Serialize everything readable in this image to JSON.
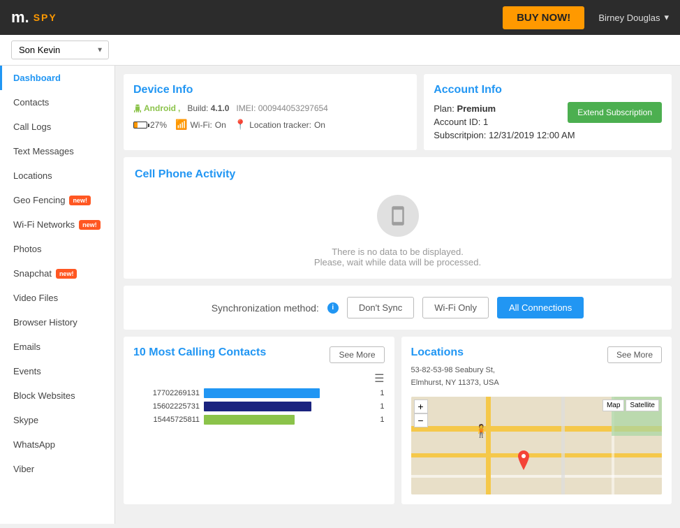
{
  "header": {
    "logo_m": "m.",
    "logo_spy": "SPY",
    "buy_now": "BUY NOW!",
    "user_name": "Birney Douglas"
  },
  "device_selector": {
    "current": "Son Kevin",
    "options": [
      "Son Kevin"
    ]
  },
  "sidebar": {
    "items": [
      {
        "label": "Dashboard",
        "active": true,
        "badge": ""
      },
      {
        "label": "Contacts",
        "active": false,
        "badge": ""
      },
      {
        "label": "Call Logs",
        "active": false,
        "badge": ""
      },
      {
        "label": "Text Messages",
        "active": false,
        "badge": ""
      },
      {
        "label": "Locations",
        "active": false,
        "badge": ""
      },
      {
        "label": "Geo Fencing",
        "active": false,
        "badge": "new!"
      },
      {
        "label": "Wi-Fi Networks",
        "active": false,
        "badge": "new!"
      },
      {
        "label": "Photos",
        "active": false,
        "badge": ""
      },
      {
        "label": "Snapchat",
        "active": false,
        "badge": "new!"
      },
      {
        "label": "Video Files",
        "active": false,
        "badge": ""
      },
      {
        "label": "Browser History",
        "active": false,
        "badge": ""
      },
      {
        "label": "Emails",
        "active": false,
        "badge": ""
      },
      {
        "label": "Events",
        "active": false,
        "badge": ""
      },
      {
        "label": "Block Websites",
        "active": false,
        "badge": ""
      },
      {
        "label": "Skype",
        "active": false,
        "badge": ""
      },
      {
        "label": "WhatsApp",
        "active": false,
        "badge": ""
      },
      {
        "label": "Viber",
        "active": false,
        "badge": ""
      }
    ]
  },
  "device_info": {
    "title": "Device Info",
    "os": "Android",
    "build_label": "Build:",
    "build_value": "4.1.0",
    "imei_label": "IMEI:",
    "imei_value": "000944053297654",
    "battery_pct": "27%",
    "wifi_label": "Wi-Fi:",
    "wifi_value": "On",
    "location_label": "Location tracker:",
    "location_value": "On"
  },
  "account_info": {
    "title": "Account Info",
    "plan_label": "Plan:",
    "plan_value": "Premium",
    "account_label": "Account ID:",
    "account_value": "1",
    "subscription_label": "Subscritpion:",
    "subscription_value": "12/31/2019 12:00 AM",
    "extend_btn": "Extend Subscription"
  },
  "cell_phone_activity": {
    "title": "Cell Phone Activity",
    "no_data_line1": "There is no data to be displayed.",
    "no_data_line2": "Please, wait while data will be processed."
  },
  "sync": {
    "label": "Synchronization method:",
    "dont_sync": "Don't Sync",
    "wifi_only": "Wi-Fi Only",
    "all_connections": "All Connections"
  },
  "contacts_chart": {
    "title": "10 Most Calling Contacts",
    "see_more": "See More",
    "bars": [
      {
        "label": "17702269131",
        "value": 1,
        "color": "#2196f3",
        "width_pct": 70
      },
      {
        "label": "15602225731",
        "value": 1,
        "color": "#1a237e",
        "width_pct": 65
      },
      {
        "label": "15445725811",
        "value": 1,
        "color": "#8bc34a",
        "width_pct": 55
      }
    ]
  },
  "locations": {
    "title": "Locations",
    "address_line1": "53-82-53-98 Seabury St,",
    "address_line2": "Elmhurst, NY 11373, USA",
    "see_more": "See More",
    "map_btn_map": "Map",
    "map_btn_satellite": "Satellite"
  }
}
